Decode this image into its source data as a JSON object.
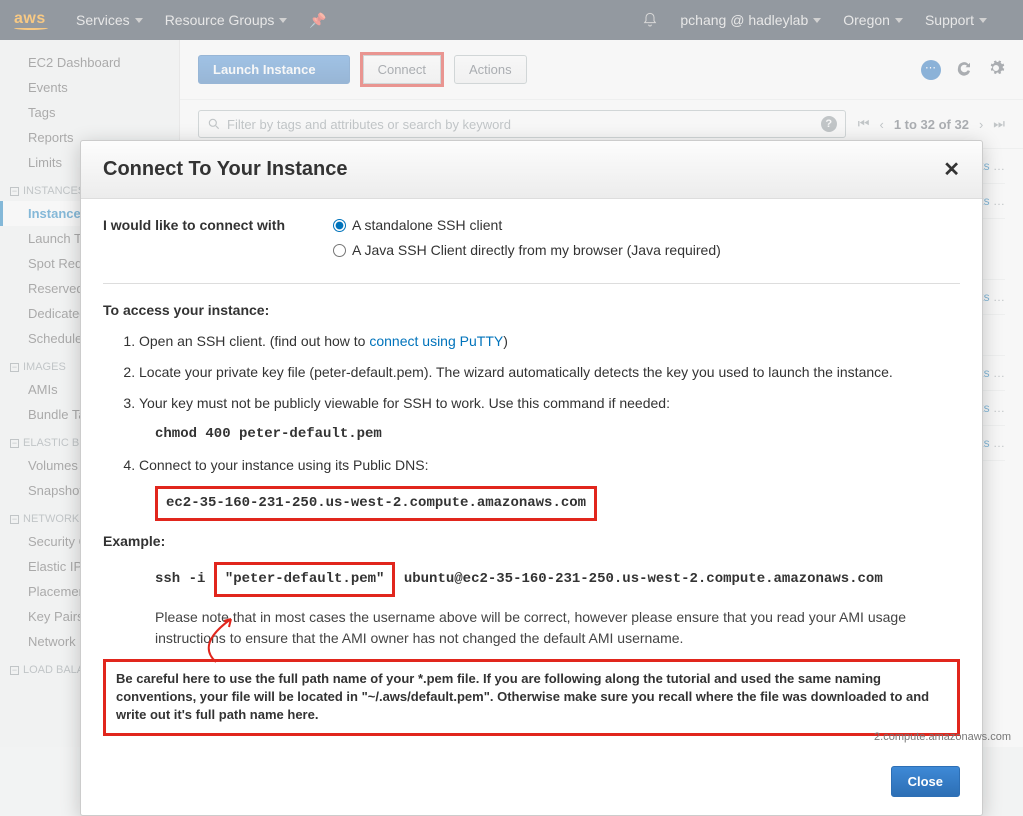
{
  "topnav": {
    "logo": "aws",
    "services": "Services",
    "resource_groups": "Resource Groups",
    "account": "pchang @ hadleylab",
    "region": "Oregon",
    "support": "Support"
  },
  "sidebar": {
    "top": [
      "EC2 Dashboard",
      "Events",
      "Tags",
      "Reports",
      "Limits"
    ],
    "sections": [
      {
        "title": "INSTANCES",
        "items": [
          "Instances",
          "Launch Templates",
          "Spot Requests",
          "Reserved Instances",
          "Dedicated Hosts",
          "Scheduled Instances"
        ],
        "active": 0
      },
      {
        "title": "IMAGES",
        "items": [
          "AMIs",
          "Bundle Tasks"
        ]
      },
      {
        "title": "ELASTIC BLOCK STORE",
        "items": [
          "Volumes",
          "Snapshots"
        ]
      },
      {
        "title": "NETWORK & SECURITY",
        "items": [
          "Security Groups",
          "Elastic IPs",
          "Placement Groups",
          "Key Pairs",
          "Network Interfaces"
        ]
      },
      {
        "title": "LOAD BALANCING",
        "items": []
      }
    ]
  },
  "toolbar": {
    "launch": "Launch Instance",
    "connect": "Connect",
    "actions": "Actions"
  },
  "search": {
    "placeholder": "Filter by tags and attributes or search by keyword"
  },
  "pager": {
    "range": "1 to 32 of 32"
  },
  "bg_rows": [
    "ks",
    "ks",
    "ks",
    "ks",
    "ks",
    "ks"
  ],
  "modal": {
    "title": "Connect To Your Instance",
    "connect_with_label": "I would like to connect with",
    "radio1": "A standalone SSH client",
    "radio2": "A Java SSH Client directly from my browser (Java required)",
    "access_heading": "To access your instance:",
    "li1_a": "Open an SSH client. (find out how to ",
    "li1_link": "connect using PuTTY",
    "li1_b": ")",
    "li2": "Locate your private key file (peter-default.pem). The wizard automatically detects the key you used to launch the instance.",
    "li3": "Your key must not be publicly viewable for SSH to work. Use this command if needed:",
    "chmod": "chmod 400 peter-default.pem",
    "li4": "Connect to your instance using its Public DNS:",
    "dns": "ec2-35-160-231-250.us-west-2.compute.amazonaws.com",
    "example_heading": "Example:",
    "ssh_pre": "ssh -i ",
    "ssh_pem": "\"peter-default.pem\"",
    "ssh_post": " ubuntu@ec2-35-160-231-250.us-west-2.compute.amazonaws.com",
    "note": "Please note that in most cases the username above will be correct, however please ensure that you read your AMI usage instructions to ensure that the AMI owner has not changed the default AMI username.",
    "warn": "Be careful here to use the full path name of your *.pem file. If you are following along the tutorial and used the same naming conventions, your file will be located in \"~/.aws/default.pem\". Otherwise make sure you recall where the file was downloaded to and write out it's full path name here.",
    "close": "Close"
  },
  "footer_url": "2.compute.amazonaws.com"
}
